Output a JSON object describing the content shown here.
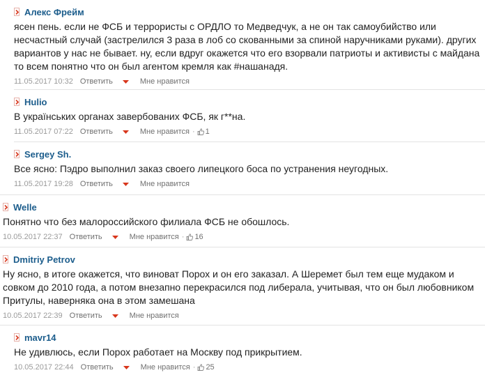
{
  "ui": {
    "reply_label": "Ответить",
    "like_label": "Мне нравится"
  },
  "comments": [
    {
      "author": "Алекс Фрейм",
      "text": "ясен пень. если не ФСБ и террористы с ОРДЛО то Медведчук, а не он так самоубийство или несчастный случай (застрелился 3 раза в лоб со скованными за спиной наручниками руками). других вариантов у нас не бывает. ну, если вдруг окажется что его взорвали патриоты и активисты с майдана то всем понятно что он был агентом кремля как #нашанадя.",
      "date": "11.05.2017 10:32",
      "likes": ""
    },
    {
      "author": "Hulio",
      "text": "В українських органах завербованих ФСБ, як г**на.",
      "date": "11.05.2017 07:22",
      "likes": "1"
    },
    {
      "author": "Sergey Sh.",
      "text": "Все ясно: Пэдро выполнил заказ своего липецкого боса по устранения неугодных.",
      "date": "11.05.2017 19:28",
      "likes": ""
    },
    {
      "author": "Welle",
      "text": "Понятно что без малороссийского филиала ФСБ не обошлось.",
      "date": "10.05.2017 22:37",
      "likes": "16"
    },
    {
      "author": "Dmitriy Petrov",
      "text": "Ну ясно, в итоге окажется, что виноват Порох и он его заказал. А Шеремет был тем еще мудаком и совком до 2010 года, а потом внезапно перекрасился под либерала, учитывая, что он был любовником Притулы, наверняка она в этом замешана",
      "date": "10.05.2017 22:39",
      "likes": ""
    },
    {
      "author": "mavr14",
      "text": "Не удивлюсь, если Порох работает на Москву под прикрытием.",
      "date": "10.05.2017 22:44",
      "likes": "25"
    }
  ]
}
